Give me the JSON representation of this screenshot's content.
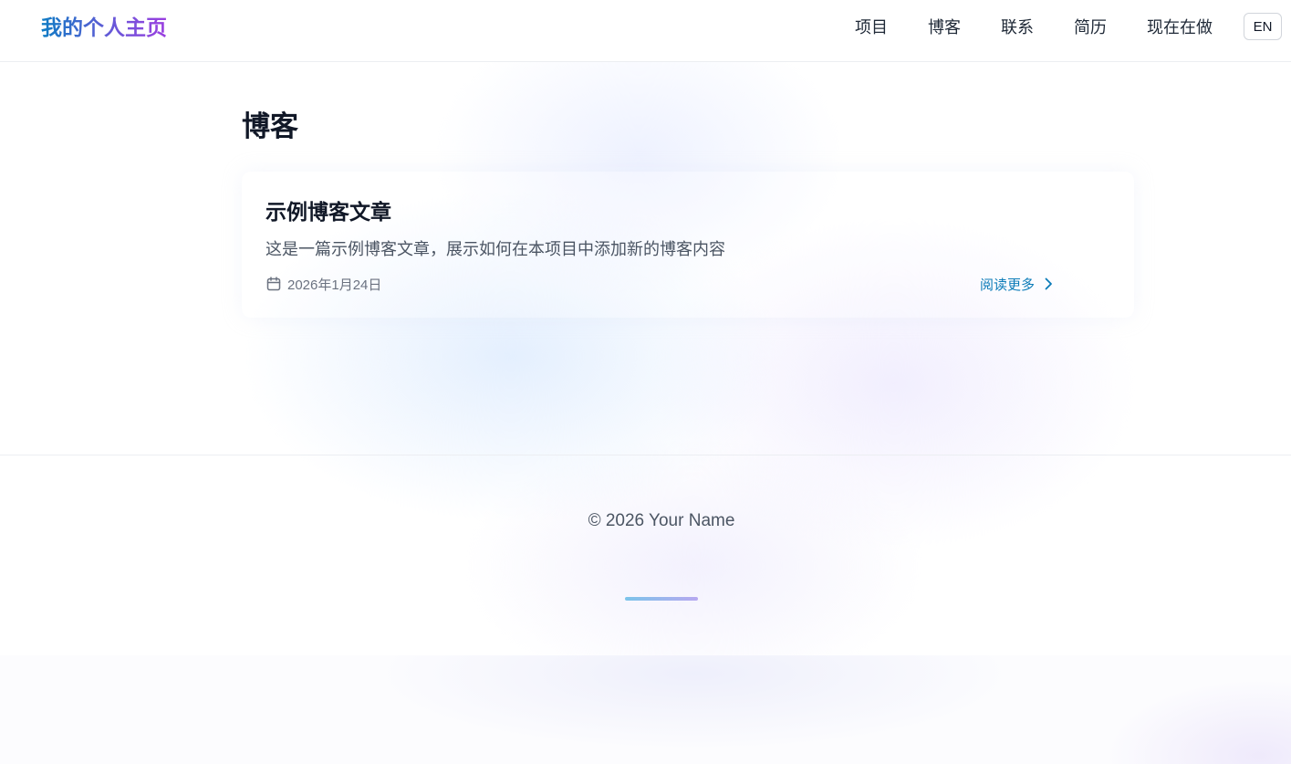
{
  "header": {
    "brand": "我的个人主页",
    "nav": [
      {
        "label": "项目"
      },
      {
        "label": "博客"
      },
      {
        "label": "联系"
      },
      {
        "label": "简历"
      },
      {
        "label": "现在在做"
      }
    ],
    "lang_button": "EN"
  },
  "main": {
    "title": "博客",
    "posts": [
      {
        "title": "示例博客文章",
        "excerpt": "这是一篇示例博客文章，展示如何在本项目中添加新的博客内容",
        "date": "2026年1月24日",
        "read_more": "阅读更多",
        "icons": {
          "date": "calendar-icon",
          "read_more": "chevron-right-icon"
        }
      }
    ]
  },
  "footer": {
    "copyright": "© 2026 Your Name"
  },
  "colors": {
    "brand_gradient_start": "#0e7cc4",
    "brand_gradient_end": "#9b3fe0",
    "link": "#0b7bb8"
  }
}
